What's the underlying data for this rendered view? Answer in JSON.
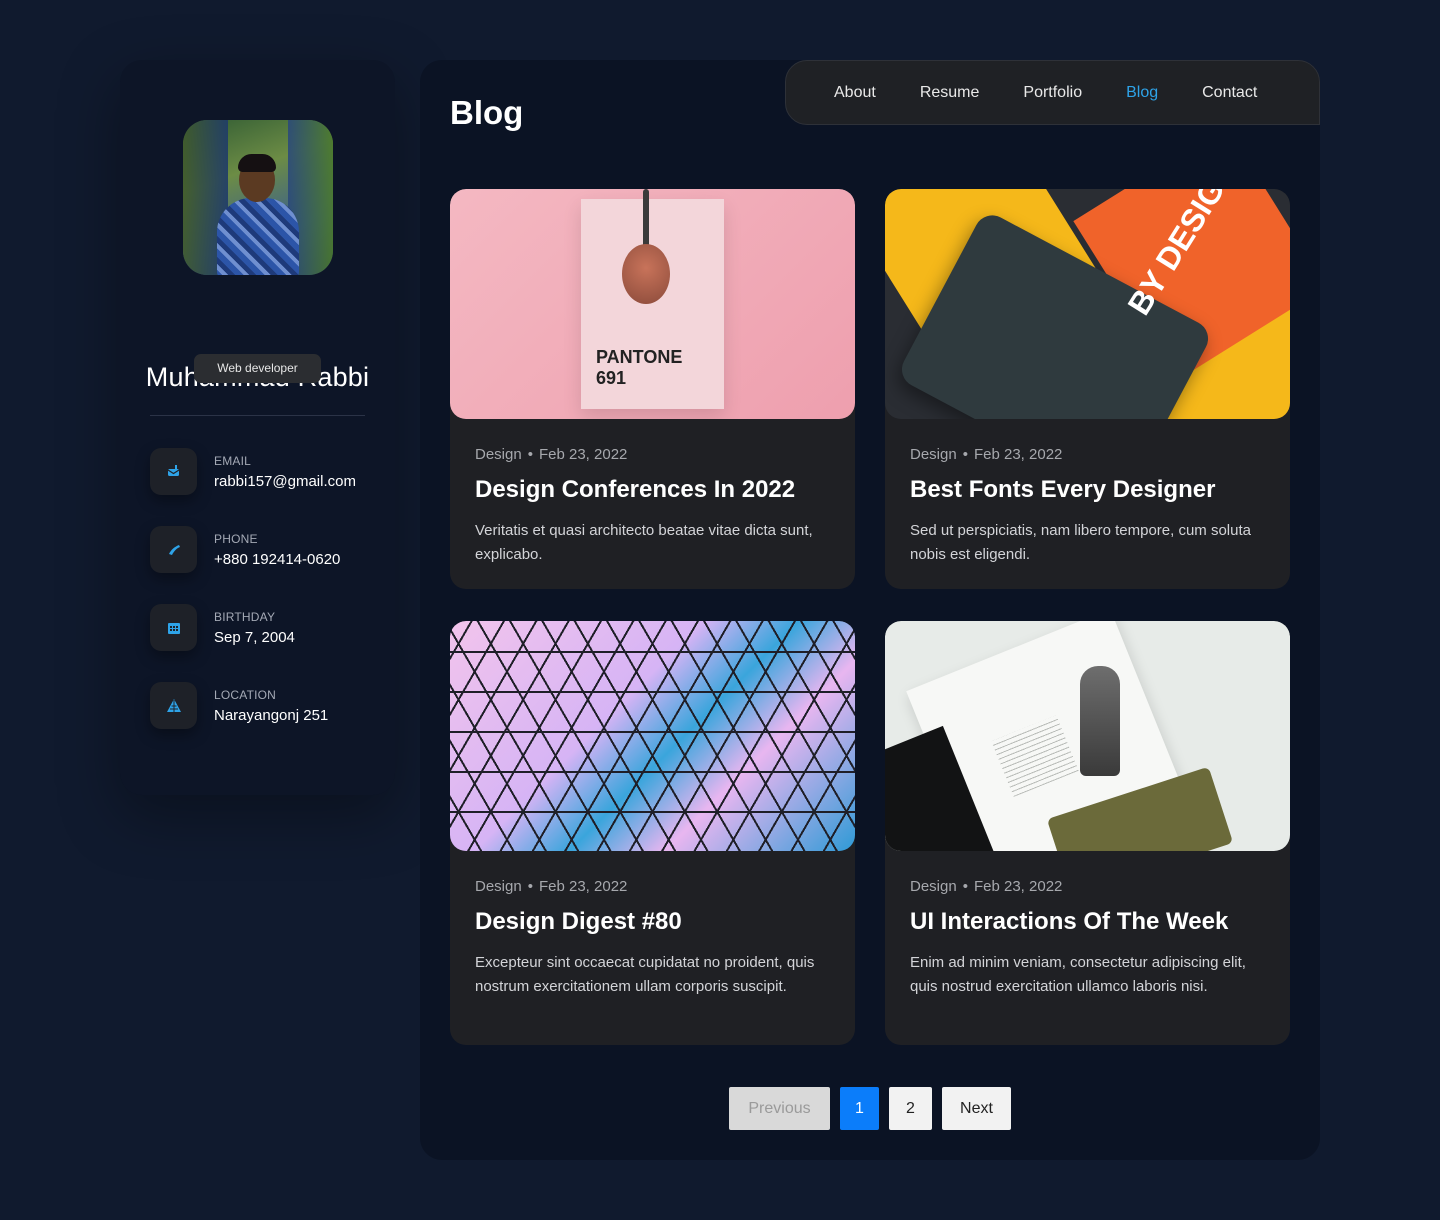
{
  "profile": {
    "name": "Muhammad Rabbi",
    "role": "Web developer"
  },
  "contacts": [
    {
      "label": "EMAIL",
      "value": "rabbi157@gmail.com",
      "icon": "mail-icon"
    },
    {
      "label": "PHONE",
      "value": "+880 192414-0620",
      "icon": "phone-icon"
    },
    {
      "label": "BIRTHDAY",
      "value": "Sep 7, 2004",
      "icon": "calendar-icon"
    },
    {
      "label": "LOCATION",
      "value": "Narayangonj 251",
      "icon": "location-icon"
    }
  ],
  "page": {
    "title": "Blog"
  },
  "nav": {
    "items": [
      "About",
      "Resume",
      "Portfolio",
      "Blog",
      "Contact"
    ],
    "active": "Blog",
    "active_color": "#2ea3e8"
  },
  "posts": [
    {
      "category": "Design",
      "date": "Feb 23, 2022",
      "title": "Design Conferences In 2022",
      "excerpt": "Veritatis et quasi architecto beatae vitae dicta sunt, explicabo.",
      "image_text": [
        "PANTONE",
        "691"
      ]
    },
    {
      "category": "Design",
      "date": "Feb 23, 2022",
      "title": "Best Fonts Every Designer",
      "excerpt": "Sed ut perspiciatis, nam libero tempore, cum soluta nobis est eligendi.",
      "image_text": [
        "BY DESIGN"
      ]
    },
    {
      "category": "Design",
      "date": "Feb 23, 2022",
      "title": "Design Digest #80",
      "excerpt": "Excepteur sint occaecat cupidatat no proident, quis nostrum exercitationem ullam corporis suscipit."
    },
    {
      "category": "Design",
      "date": "Feb 23, 2022",
      "title": "UI Interactions Of The Week",
      "excerpt": "Enim ad minim veniam, consectetur adipiscing elit, quis nostrud exercitation ullamco laboris nisi."
    }
  ],
  "pagination": {
    "previous": "Previous",
    "pages": [
      "1",
      "2"
    ],
    "current": "1",
    "next": "Next",
    "active_color": "#0b7dfa"
  },
  "colors": {
    "background": "#101a2e",
    "accent": "#2ea3e8"
  }
}
